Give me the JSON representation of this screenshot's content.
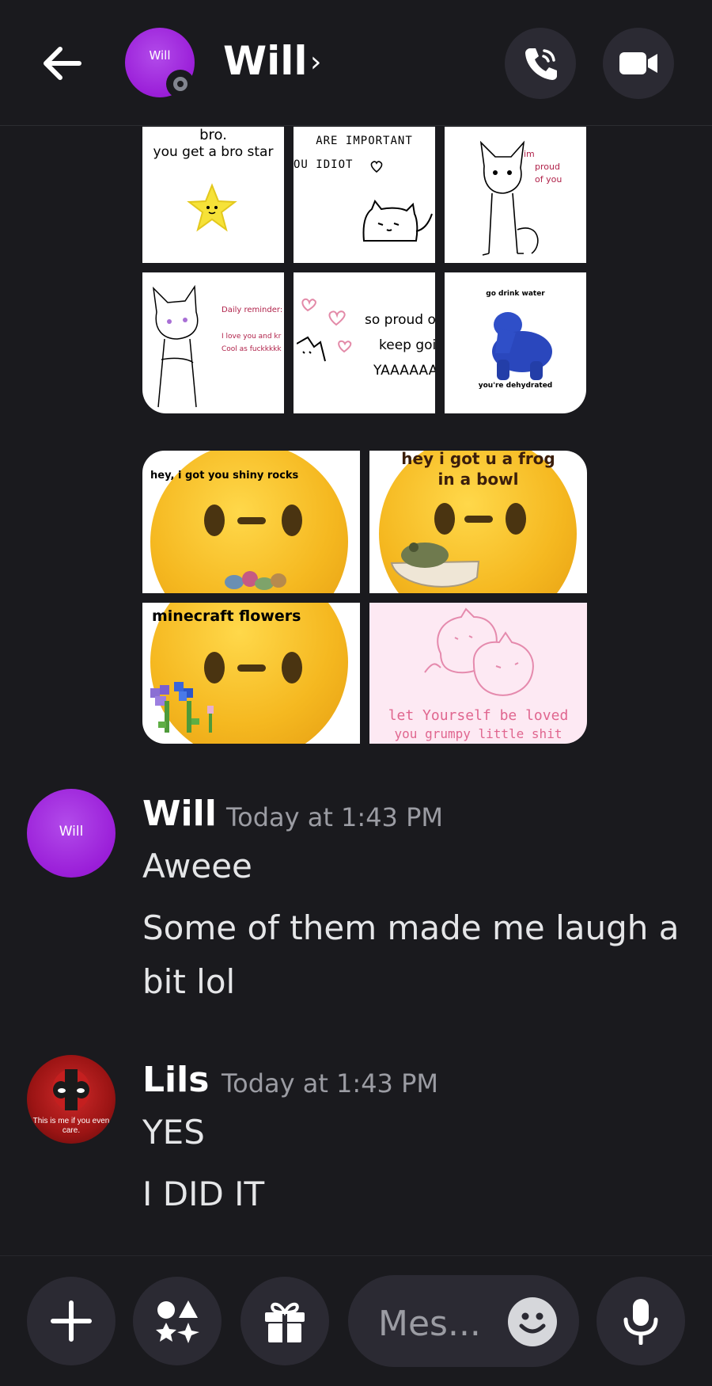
{
  "header": {
    "title": "Will",
    "avatar_text": "Will",
    "back_icon": "arrow-left-icon",
    "call_icon": "phone-icon",
    "video_icon": "video-camera-icon"
  },
  "stickers_grid1": [
    {
      "line1": "bro.",
      "line2": "you get a bro star"
    },
    {
      "line1": "ARE IMPORTANT",
      "line2": "OU IDIOT"
    },
    {
      "line1": "im",
      "line2": "proud",
      "line3": "of you"
    },
    {
      "line1": "Daily reminder:",
      "line2": "I love you and kr",
      "line3": "Cool as fuckkkkk"
    },
    {
      "line1": "so proud of",
      "line2": "keep goir",
      "line3": "YAAAAAA"
    },
    {
      "line1": "go drink water",
      "line2": "you're dehydrated"
    }
  ],
  "stickers_grid2": [
    {
      "caption": "hey, i got you shiny rocks"
    },
    {
      "caption1": "hey i got u a frog",
      "caption2": "in a bowl"
    },
    {
      "caption": "minecraft flowers"
    },
    {
      "caption1": "let Yourself be loved",
      "caption2": "you grumpy little shit"
    }
  ],
  "messages": [
    {
      "author": "Will",
      "avatar_text": "Will",
      "time": "Today at 1:43 PM",
      "lines": [
        "Aweee",
        "Some of them made me laugh a",
        "bit lol"
      ]
    },
    {
      "author": "Lils",
      "avatar_text": "This is me if you even care.",
      "time": "Today at 1:43 PM",
      "lines": [
        "YES",
        "I DID IT"
      ]
    }
  ],
  "composer": {
    "placeholder": "Mes...",
    "plus_icon": "plus-icon",
    "apps_icon": "apps-icon",
    "gift_icon": "gift-icon",
    "emoji_icon": "emoji-icon",
    "mic_icon": "microphone-icon"
  },
  "colors": {
    "background": "#1a1a1e",
    "accent_purple": "#9a1ed8",
    "button_bg": "#2b2a33"
  }
}
